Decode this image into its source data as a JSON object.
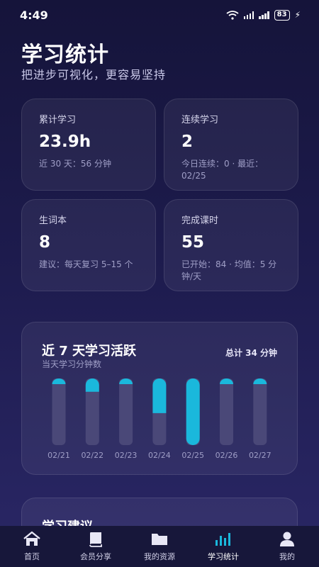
{
  "status": {
    "time": "4:49",
    "battery": "83"
  },
  "header": {
    "title": "学习统计",
    "subtitle": "把进步可视化，更容易坚持"
  },
  "stats": [
    {
      "label": "累计学习",
      "value": "23.9h",
      "note": "近 30 天：56 分钟"
    },
    {
      "label": "连续学习",
      "value": "2",
      "note": "今日连续：0 · 最近：02/25"
    },
    {
      "label": "生词本",
      "value": "8",
      "note": "建议：每天复习 5–15 个"
    },
    {
      "label": "完成课时",
      "value": "55",
      "note": "已开始：84 · 均值：5 分钟/天"
    }
  ],
  "activity": {
    "title": "近 7 天学习活跃",
    "subtitle": "当天学习分钟数",
    "total": "总计 34 分钟"
  },
  "chart_data": {
    "type": "bar",
    "categories": [
      "02/21",
      "02/22",
      "02/23",
      "02/24",
      "02/25",
      "02/26",
      "02/27"
    ],
    "values": [
      1,
      5,
      1,
      13,
      25,
      1,
      1
    ],
    "ylim": [
      0,
      25
    ],
    "colors": {
      "fill": "#1ab8dc",
      "track": "#4a4878"
    }
  },
  "advice": {
    "title": "学习建议"
  },
  "nav": [
    {
      "label": "首页",
      "icon": "home-icon"
    },
    {
      "label": "会员分享",
      "icon": "book-icon"
    },
    {
      "label": "我的资源",
      "icon": "folder-icon"
    },
    {
      "label": "学习统计",
      "icon": "bar-chart-icon"
    },
    {
      "label": "我的",
      "icon": "user-icon"
    }
  ]
}
